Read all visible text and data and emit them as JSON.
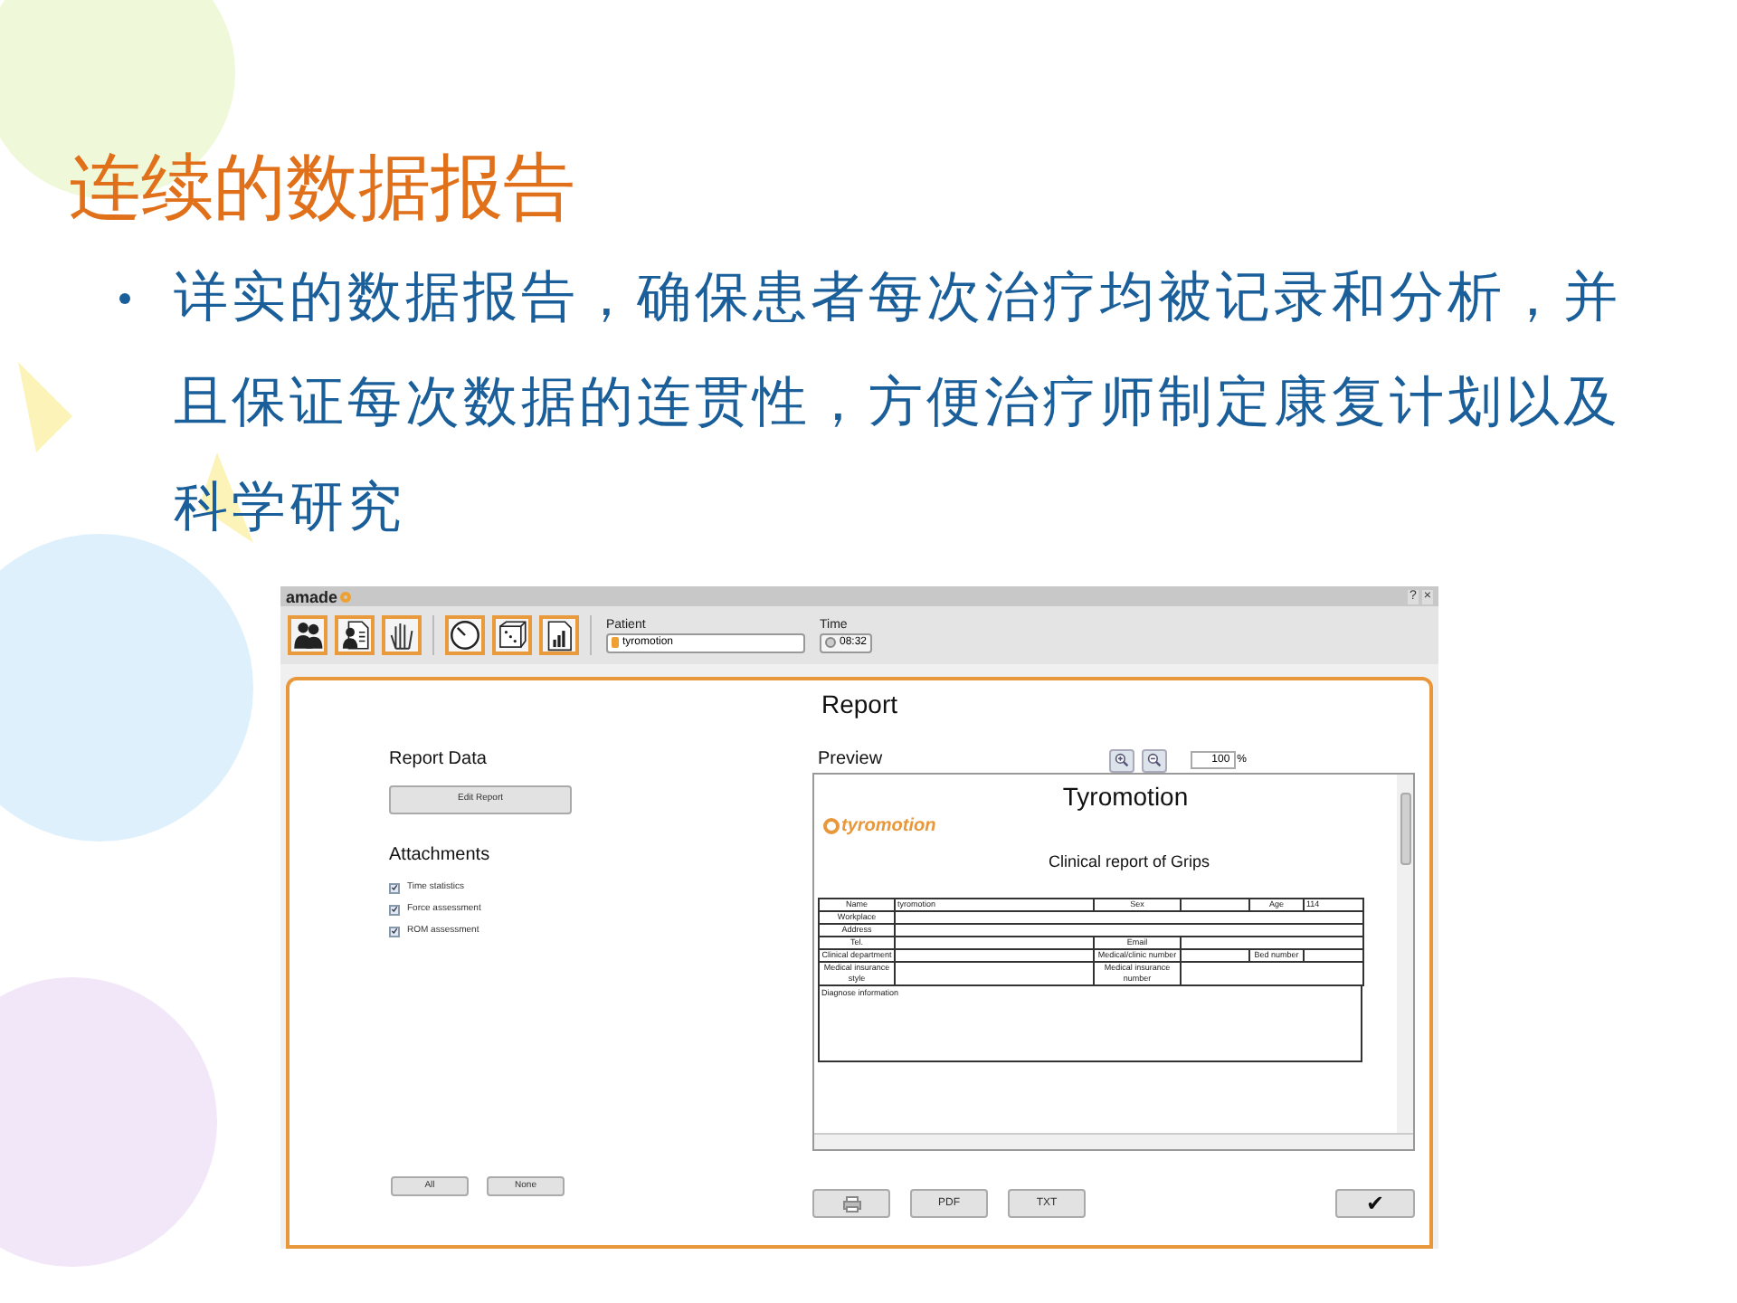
{
  "slide": {
    "title": "连续的数据报告",
    "bullets": [
      "详实的数据报告，确保患者每次治疗均被记录和分析，并且保证每次数据的连贯性，方便治疗师制定康复计划以及科学研究"
    ]
  },
  "app": {
    "logo": "amade",
    "window_buttons": [
      "?",
      "×"
    ],
    "patient": {
      "label": "Patient",
      "value": "tyromotion"
    },
    "time": {
      "label": "Time",
      "value": "08:32"
    },
    "report": {
      "title": "Report",
      "report_data_heading": "Report Data",
      "edit_button": "Edit Report",
      "attachments_heading": "Attachments",
      "attachments": [
        {
          "label": "Time statistics",
          "checked": true
        },
        {
          "label": "Force assessment",
          "checked": true
        },
        {
          "label": "ROM assessment",
          "checked": true
        }
      ],
      "select_buttons": [
        "All",
        "None"
      ],
      "preview_heading": "Preview",
      "zoom_value": "100",
      "zoom_unit": "%",
      "document": {
        "title": "Tyromotion",
        "logo": "tyromotion",
        "subtitle": "Clinical report of Grips",
        "rows": [
          [
            {
              "text": "Name",
              "kind": "label"
            },
            {
              "text": "tyromotion",
              "kind": "value"
            },
            {
              "text": "Sex",
              "kind": "label"
            },
            {
              "kind": "value"
            },
            {
              "text": "Age",
              "kind": "label"
            },
            {
              "text": "114",
              "kind": "value"
            }
          ],
          [
            {
              "text": "Workplace",
              "kind": "label"
            },
            {
              "kind": "value"
            }
          ],
          [
            {
              "text": "Address",
              "kind": "label"
            },
            {
              "kind": "value"
            }
          ],
          [
            {
              "text": "Tel.",
              "kind": "label"
            },
            {
              "kind": "value"
            },
            {
              "text": "Email",
              "kind": "label"
            },
            {
              "kind": "value"
            }
          ],
          [
            {
              "text": "Clinical department",
              "kind": "label"
            },
            {
              "kind": "value"
            },
            {
              "text": "Medical/clinic number",
              "kind": "label"
            },
            {
              "kind": "value"
            },
            {
              "text": "Bed number",
              "kind": "label"
            },
            {
              "kind": "value"
            }
          ],
          [
            {
              "text": "Medical insurance style",
              "kind": "label"
            },
            {
              "kind": "value"
            },
            {
              "text": "Medical insurance number",
              "kind": "label"
            },
            {
              "kind": "value"
            }
          ]
        ],
        "diagnose": "Diagnose information"
      },
      "export_buttons": [
        {
          "kind": "print"
        },
        {
          "kind": "text",
          "label": "PDF"
        },
        {
          "kind": "text",
          "label": "TXT"
        }
      ],
      "confirm": "✔"
    }
  }
}
